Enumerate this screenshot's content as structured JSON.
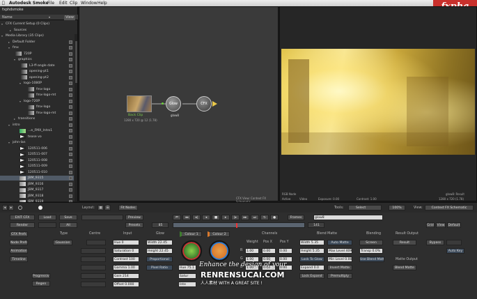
{
  "menubar": {
    "apple": "",
    "app": "Autodesk Smoke",
    "items": [
      "File",
      "Edit",
      "Clip",
      "Window",
      "Help"
    ]
  },
  "logo": {
    "text": "fxpha"
  },
  "library": {
    "project": "fxphdsmoke",
    "name_header": "Name",
    "view_button": "View",
    "rows": [
      {
        "label": "CFX Current Setup (0 Clips)",
        "indent": 2,
        "arrow": "▾",
        "chk": false
      },
      {
        "label": "Sources",
        "indent": 14,
        "arrow": "▸",
        "chk": false
      },
      {
        "label": "Media Library (35 Clips)",
        "indent": 2,
        "arrow": "▾",
        "chk": false
      },
      {
        "label": "Default Folder",
        "indent": 12,
        "arrow": "▸",
        "chk": true
      },
      {
        "label": "fmx",
        "indent": 12,
        "arrow": "▾",
        "chk": true
      },
      {
        "label": "720P",
        "indent": 34,
        "thumb": "dark",
        "chk": true
      },
      {
        "label": "graphics",
        "indent": 20,
        "arrow": "▾",
        "chk": true
      },
      {
        "label": "L3-ff-angle date",
        "indent": 42,
        "thumb": "dark",
        "chk": true
      },
      {
        "label": "opening-pt1",
        "indent": 42,
        "thumb": "dark",
        "chk": true
      },
      {
        "label": "opening-pt2",
        "indent": 42,
        "thumb": "dark",
        "chk": true
      },
      {
        "label": "logo-1080P",
        "indent": 28,
        "arrow": "▾",
        "chk": true
      },
      {
        "label": "fmx-logo",
        "indent": 52,
        "thumb": "dark",
        "chk": true
      },
      {
        "label": "fmx-logo-mt",
        "indent": 52,
        "thumb": "dark",
        "chk": true
      },
      {
        "label": "logo-720P",
        "indent": 28,
        "arrow": "▾",
        "chk": true
      },
      {
        "label": "fmx-logo",
        "indent": 52,
        "thumb": "dark",
        "chk": true
      },
      {
        "label": "fmx-logo-mt",
        "indent": 52,
        "thumb": "dark",
        "chk": true
      },
      {
        "label": "transitions",
        "indent": 20,
        "arrow": "▸",
        "chk": true
      },
      {
        "label": "intro",
        "indent": 12,
        "arrow": "▾",
        "chk": true
      },
      {
        "label": "...e_FMX_Intro1",
        "indent": 40,
        "thumb": "green",
        "chk": true
      },
      {
        "label": "tease vo",
        "indent": 40,
        "thumb": "arrowt",
        "chk": true
      },
      {
        "label": "john-lan",
        "indent": 12,
        "arrow": "▾",
        "chk": true
      },
      {
        "label": "120511-006",
        "indent": 40,
        "thumb": "arrowt",
        "chk": true
      },
      {
        "label": "120511-007",
        "indent": 40,
        "thumb": "arrowt",
        "chk": true
      },
      {
        "label": "120511-008",
        "indent": 40,
        "thumb": "arrowt",
        "chk": true
      },
      {
        "label": "120511-009",
        "indent": 40,
        "thumb": "arrowt",
        "chk": true
      },
      {
        "label": "120511-010",
        "indent": 40,
        "thumb": "arrowt",
        "chk": true
      },
      {
        "label": "JBM_9315",
        "indent": 40,
        "thumb": "normal",
        "chk": true,
        "sel": true
      },
      {
        "label": "JBM_9316",
        "indent": 40,
        "thumb": "normal",
        "chk": true
      },
      {
        "label": "JBM_9317",
        "indent": 40,
        "thumb": "normal",
        "chk": true
      },
      {
        "label": "JBM_9318",
        "indent": 40,
        "thumb": "normal",
        "chk": true
      },
      {
        "label": "JBM_9319",
        "indent": 40,
        "thumb": "normal",
        "chk": true
      }
    ]
  },
  "schematic": {
    "clip_name": "Back Clip",
    "clip_info": "1280 x 720 @ 12 (1.78)",
    "glow_node": "Glow",
    "glow_caption": "glow8",
    "cfx_node": "CFX",
    "footer": "CFX View: Context FX Schematic"
  },
  "viewer": {
    "top_left": "RGB Node",
    "active": "Active",
    "video": "Video",
    "exposure": "Exposure: 0.00",
    "contrast": "Contrast: 1.00",
    "bottom_right_1": "glow8: Result",
    "bottom_right_2": "1280 x 720 (1.78)"
  },
  "transport": {
    "layout_label": "Layout:",
    "fit_nodes": "Fit Nodes",
    "tools_label": "Tools:",
    "tools_value": "Select",
    "zoom": "100%",
    "view_label": "View:",
    "view_value": "Context FX Schematic"
  },
  "panel": {
    "exit": "EXIT CFX",
    "load": "Load",
    "save": "Save",
    "preview": "Preview",
    "presets": "Presets",
    "render": "Render",
    "all": "All",
    "frames_label": "Frames",
    "clip_field": "glow8",
    "frame_start": "85",
    "frame_end": "141",
    "grid": "Grid",
    "view": "View",
    "default": "Default",
    "cfx_prefs": "CFX Prefs",
    "node_prefs": "Node Prefs",
    "animation": "Animation",
    "timeline": "Timeline",
    "progressive": "Progressive",
    "regen": "Regen",
    "type_label": "Type",
    "type_value": "Gaussian",
    "centre_label": "Centre",
    "input_label": "Input",
    "hue": "Hue 0",
    "saturation": "Saturation 0",
    "contrast": "Contrast 100",
    "gamma": "Gamma 1.00",
    "gain": "Gain 214",
    "offset": "Offset 0.000",
    "glow_label": "Glow",
    "width": "Width 22.45",
    "height": "Height 22.45",
    "proportional": "Proportional",
    "pixel_ratio": "Pixel Ratio",
    "colour1": "Colour 1",
    "colour2": "Colour 2",
    "hue2": "Hue 75.1",
    "sat_short": "Satur",
    "int_short": "Inte",
    "channels_label": "Channels",
    "weight_label": "Weight",
    "posx_label": "Pos X",
    "posy_label": "Pos Y",
    "r": "R",
    "g": "G",
    "b": "B",
    "w_r": "1.00",
    "w_g": "1.00",
    "w_b": "1.00",
    "px_r": "0.00",
    "px_g": "0.00",
    "px_b": "0.00",
    "py_r": "0.00",
    "py_g": "0.00",
    "py_b": "0.00",
    "blend_matte_label": "Blend Matte",
    "bm_width": "Width 5.35",
    "bm_height": "Height 5.35",
    "auto_matte": "Auto Matte",
    "max_level": "Max Level 4095",
    "lock_to_glow": "Lock To Glow",
    "min_level": "Min Level 0.00",
    "expand": "Expand 0.0",
    "invert_matte": "Invert Matte",
    "lock_expand": "Lock Expand",
    "premultiply": "Premultiply",
    "blending_label": "Blending",
    "screen": "Screen",
    "transp": "Transp 0.0%",
    "use_blend_matte": "Use Blend Matte",
    "result_output_label": "Result Output",
    "result": "Result",
    "bypass": "Bypass",
    "auto_key": "Auto Key",
    "matte_output_label": "Matte Output",
    "blend_matte_out": "Blend Matte"
  },
  "watermark": {
    "line1": "Enhance the design of your",
    "line2": "RENRENSUCAI.COM",
    "line3": "人人素材",
    "line4": "WITH A GREAT SITE !"
  },
  "colors": {
    "accent": "#5fa83a",
    "colour1": "#3e7d2e",
    "colour2": "#d8792d",
    "selection": "#505a66"
  }
}
